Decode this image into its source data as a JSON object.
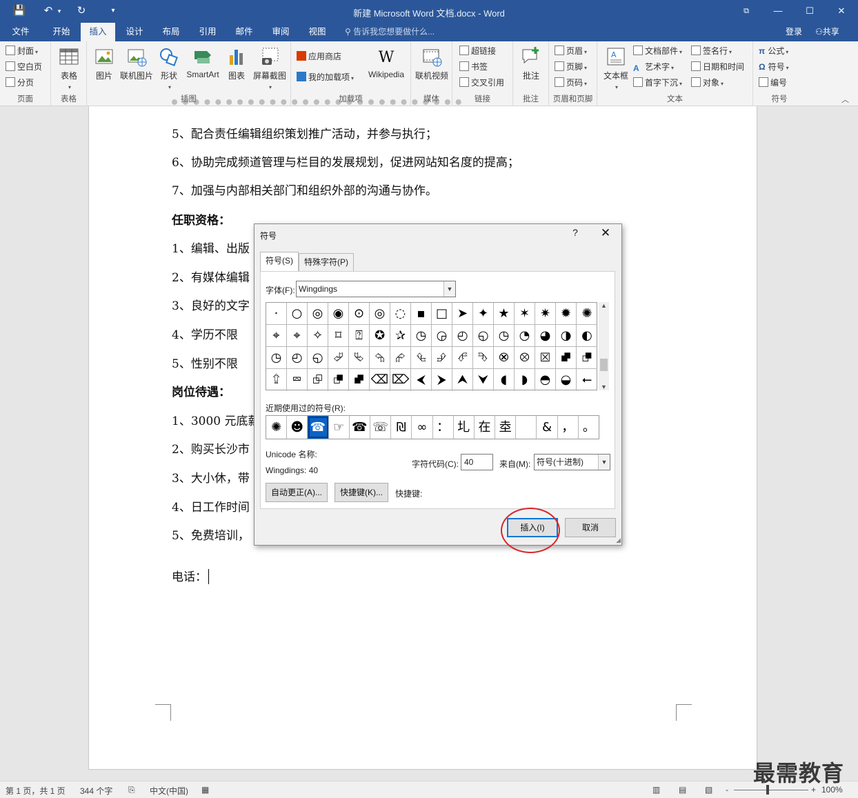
{
  "window": {
    "title": "新建 Microsoft Word 文档.docx - Word",
    "controls": {
      "restore_ribbon": "⧉",
      "minimize": "—",
      "maximize": "☐",
      "close": "✕"
    }
  },
  "quick_access": {
    "save": "💾",
    "undo": "↶",
    "undo_caret": "▾",
    "redo": "↻",
    "customize": "▾"
  },
  "tabs": [
    "文件",
    "开始",
    "插入",
    "设计",
    "布局",
    "引用",
    "邮件",
    "审阅",
    "视图"
  ],
  "active_tab": "插入",
  "tell_me": "告诉我您想要做什么...",
  "account": {
    "login": "登录",
    "share": "共享"
  },
  "ribbon": {
    "groups": {
      "pages": {
        "label": "页面",
        "items": [
          "封面",
          "空白页",
          "分页"
        ]
      },
      "tables": {
        "label": "表格",
        "items": [
          "表格"
        ]
      },
      "illustrations": {
        "label": "插图",
        "items": [
          "图片",
          "联机图片",
          "形状",
          "SmartArt",
          "图表",
          "屏幕截图"
        ]
      },
      "addins": {
        "label": "加载项",
        "items": [
          "应用商店",
          "我的加载项",
          "Wikipedia"
        ]
      },
      "media": {
        "label": "媒体",
        "items": [
          "联机视频"
        ]
      },
      "links": {
        "label": "链接",
        "items": [
          "超链接",
          "书签",
          "交叉引用"
        ]
      },
      "comments": {
        "label": "批注",
        "items": [
          "批注"
        ]
      },
      "header_footer": {
        "label": "页眉和页脚",
        "items": [
          "页眉",
          "页脚",
          "页码"
        ]
      },
      "text": {
        "label": "文本",
        "items": [
          "文本框",
          "文档部件",
          "艺术字",
          "首字下沉",
          "签名行",
          "日期和时间",
          "对象"
        ]
      },
      "symbols": {
        "label": "符号",
        "items": [
          "公式",
          "符号",
          "编号"
        ]
      }
    }
  },
  "document": {
    "paragraphs": [
      "5、配合责任编辑组织策划推广活动，并参与执行；",
      "6、协助完成频道管理与栏目的发展规划，促进网站知名度的提高；",
      "7、加强与内部相关部门和组织外部的沟通与协作。",
      "任职资格：",
      "1、编辑、出版",
      "2、有媒体编辑",
      "3、良好的文字",
      "4、学历不限",
      "5、性别不限",
      "岗位待遇：",
      "1、3000 元底薪",
      "2、购买长沙市",
      "3、大小休，带",
      "4、日工作时间",
      "5、免费培训，",
      "电话："
    ]
  },
  "dialog": {
    "title": "符号",
    "help": "?",
    "close": "✕",
    "tabs": [
      "符号(S)",
      "特殊字符(P)"
    ],
    "font_label": "字体(F):",
    "font_value": "Wingdings",
    "symbols": [
      "·",
      "○",
      "◎",
      "◉",
      "⊙",
      "◎",
      "◌",
      "▪",
      "□",
      "➤",
      "✦",
      "★",
      "✶",
      "✷",
      "✹",
      "✺",
      "⌖",
      "⌖",
      "✧",
      "⌑",
      "⍰",
      "✪",
      "✰",
      "◷",
      "◶",
      "◴",
      "◵",
      "◷",
      "◔",
      "◕",
      "◑",
      "◐",
      "◷",
      "◴",
      "◵",
      "⮰",
      "⮱",
      "⮲",
      "⮳",
      "⮴",
      "⮵",
      "⮶",
      "⮷",
      "⮿",
      "⮾",
      "⮽",
      "⮼",
      "⮻",
      "⮸",
      "⮹",
      "⮺",
      "⮻",
      "⮼",
      "⌫",
      "⌦",
      "⮜",
      "⮞",
      "⮝",
      "⮟",
      "◖",
      "◗",
      "◓",
      "◒",
      "⭠"
    ],
    "recent_label": "近期使用过的符号(R):",
    "recent_symbols": [
      "✺",
      "☻",
      "☎",
      "☞",
      "☎",
      "☏",
      "₪",
      "∞",
      "：",
      "圠",
      "在",
      "坴",
      " ",
      "&",
      "，",
      "。"
    ],
    "selected_recent_index": 2,
    "unicode_name_label": "Unicode 名称:",
    "unicode_name_value": "Wingdings: 40",
    "char_code_label": "字符代码(C):",
    "char_code_value": "40",
    "from_label": "来自(M):",
    "from_value": "符号(十进制)",
    "autocorrect_button": "自动更正(A)...",
    "shortcut_key_button": "快捷键(K)...",
    "shortcut_label": "快捷键:",
    "insert_button": "插入(I)",
    "cancel_button": "取消"
  },
  "statusbar": {
    "page": "第 1 页，共 1 页",
    "words": "344 个字",
    "language": "中文(中国)",
    "zoom_minus": "-",
    "zoom_plus": "+",
    "zoom": "100%"
  },
  "watermark": "最需教育",
  "colors": {
    "word_blue": "#2b579a",
    "highlight_red": "#d9262c",
    "selected_blue": "#0a63c7"
  }
}
